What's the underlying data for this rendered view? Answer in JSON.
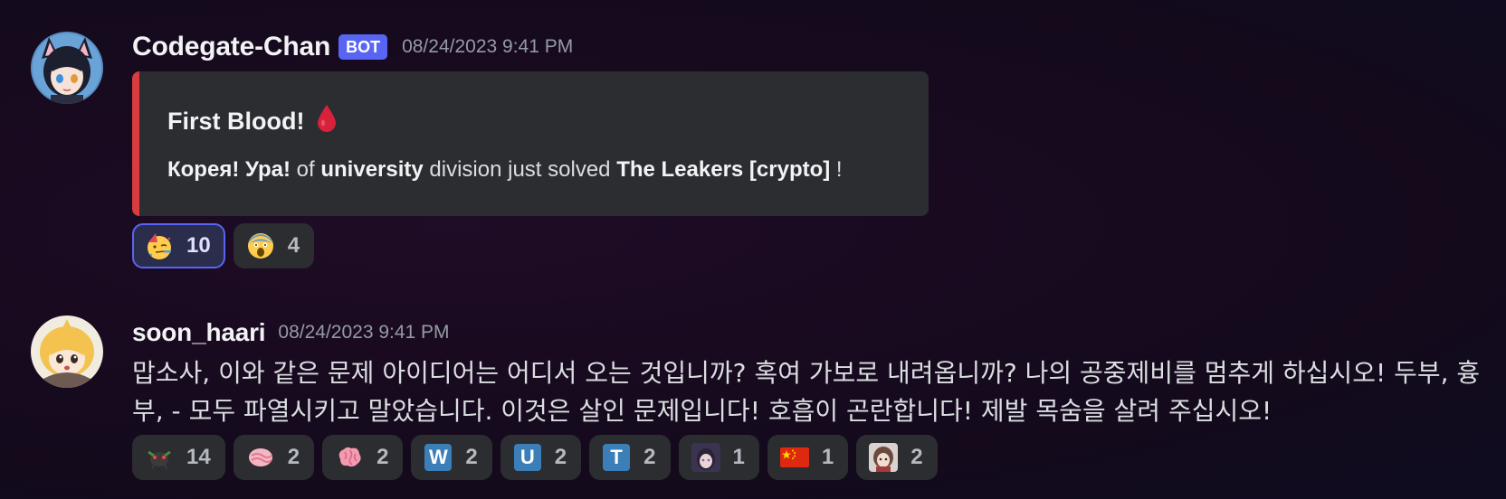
{
  "colors": {
    "embed_border": "#d83c3e",
    "bot_tag": "#5865f2",
    "reaction_active_border": "#5865f2"
  },
  "messages": [
    {
      "author": "Codegate-Chan",
      "bot_tag": "BOT",
      "timestamp": "08/24/2023 9:41 PM",
      "avatar": "anime-girl-avatar",
      "embed": {
        "title": "First Blood!",
        "title_icon": "blood-drop-icon",
        "desc": {
          "team": "Корея! Ура!",
          "of": " of ",
          "division": "university",
          "mid": " division just solved ",
          "challenge": "The Leakers [crypto]",
          "end": " !"
        }
      },
      "reactions": [
        {
          "emoji": "partying-face-icon",
          "count": "10",
          "active": true
        },
        {
          "emoji": "screaming-face-icon",
          "count": "4",
          "active": false
        }
      ]
    },
    {
      "author": "soon_haari",
      "timestamp": "08/24/2023 9:41 PM",
      "avatar": "blonde-anime-avatar",
      "text": "맙소사, 이와 같은 문제 아이디어는 어디서 오는 것입니까? 혹여 가보로 내려옵니까? 나의 공중제비를 멈추게 하십시오! 두부, 흉부, - 모두 파열시키고 말았습니다. 이것은 살인 문제입니다! 호흡이 곤란합니다! 제발 목숨을 살려 주십시오!",
      "reactions": [
        {
          "emoji": "custom-creature-icon",
          "count": "14"
        },
        {
          "emoji": "custom-pink-icon",
          "count": "2"
        },
        {
          "emoji": "brain-icon",
          "count": "2"
        },
        {
          "emoji": "letter-w-icon",
          "letter": "W",
          "count": "2"
        },
        {
          "emoji": "letter-u-icon",
          "letter": "U",
          "count": "2"
        },
        {
          "emoji": "letter-t-icon",
          "letter": "T",
          "count": "2"
        },
        {
          "emoji": "custom-avatar-icon",
          "count": "1"
        },
        {
          "emoji": "china-flag-icon",
          "count": "1"
        },
        {
          "emoji": "custom-avatar-2-icon",
          "count": "2"
        }
      ]
    }
  ]
}
